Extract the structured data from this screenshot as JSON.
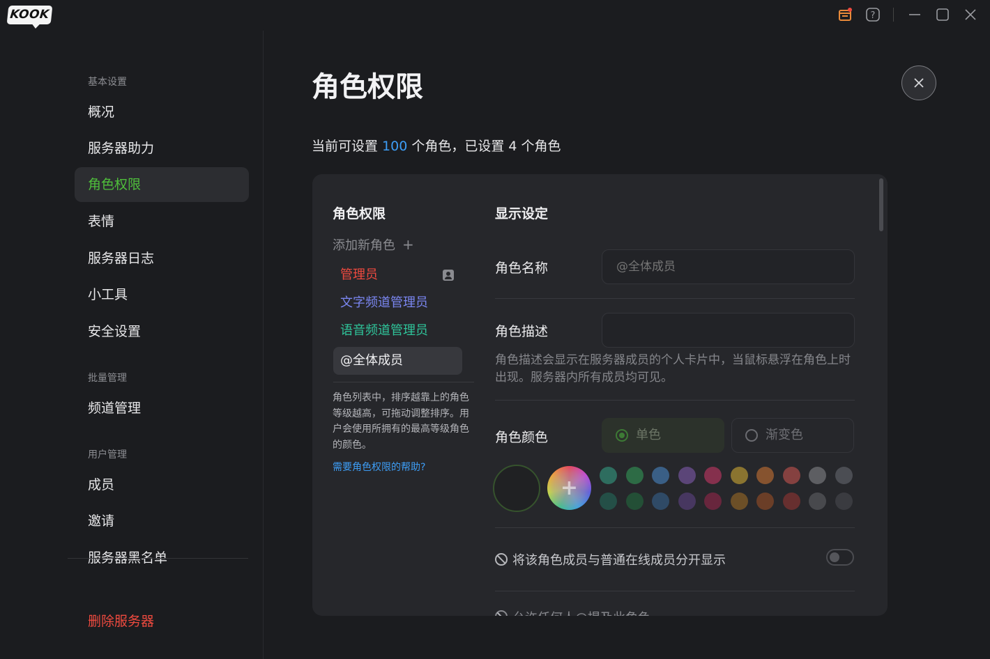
{
  "app": {
    "logo_text": "KOOK"
  },
  "titlebar": {
    "icons": [
      "store-icon",
      "help-icon",
      "minimize-icon",
      "maximize-icon",
      "close-icon"
    ]
  },
  "sidebar": {
    "sections": [
      {
        "label": "基本设置"
      },
      {
        "label": "批量管理"
      },
      {
        "label": "用户管理"
      }
    ],
    "items": [
      {
        "label": "概况"
      },
      {
        "label": "服务器助力"
      },
      {
        "label": "角色权限"
      },
      {
        "label": "表情"
      },
      {
        "label": "服务器日志"
      },
      {
        "label": "小工具"
      },
      {
        "label": "安全设置"
      },
      {
        "label": "频道管理"
      },
      {
        "label": "成员"
      },
      {
        "label": "邀请"
      },
      {
        "label": "服务器黑名单"
      }
    ],
    "active_index": 2,
    "delete_label": "删除服务器"
  },
  "page": {
    "title": "角色权限",
    "summary": {
      "prefix": "当前可设置 ",
      "max": "100",
      "middle": " 个角色，已设置 ",
      "count": "4",
      "suffix": " 个角色"
    }
  },
  "roles_panel": {
    "title": "角色权限",
    "add_label": "添加新角色",
    "add_icon": "+",
    "roles": [
      {
        "name": "管理员",
        "color": "#ef4a3f"
      },
      {
        "name": "文字频道管理员",
        "color": "#7a86f0"
      },
      {
        "name": "语音频道管理员",
        "color": "#2fc49a"
      },
      {
        "name": "@全体成员",
        "color": "#f0f0f2"
      }
    ],
    "selected_index": 3,
    "note": "角色列表中，排序越靠上的角色等级越高，可拖动调整排序。用户会使用所拥有的最高等级角色的颜色。",
    "help_link": "需要角色权限的帮助?"
  },
  "display": {
    "title": "显示设定",
    "name_label": "角色名称",
    "name_placeholder": "@全体成员",
    "desc_label": "角色描述",
    "desc_value": "",
    "desc_note": "角色描述会显示在服务器成员的个人卡片中，当鼠标悬浮在角色上时出现。服务器内所有成员均可见。",
    "color_label": "角色颜色",
    "color_mode_solid": "单色",
    "color_mode_gradient": "渐变色",
    "color_mode_selected": "单色",
    "swatch_row1": [
      "#2e6d5f",
      "#2d6b45",
      "#3a5f86",
      "#5b4578",
      "#85304d",
      "#8a7430",
      "#86532f",
      "#854140",
      "#5d5e62",
      "#4b4d53"
    ],
    "swatch_row2": [
      "#244f47",
      "#234f36",
      "#2f4a66",
      "#473760",
      "#68263d",
      "#6c4f27",
      "#6b3e27",
      "#672f2f",
      "#48494d",
      "#3a3b40"
    ],
    "separate_label": "将该角色成员与普通在线成员分开显示",
    "separate_on": false,
    "mention_label": "允许任何人@提及此角色"
  },
  "colors": {
    "accent_green": "#4fbf3b",
    "link_blue": "#3d9df5",
    "danger_red": "#ef4a3f"
  }
}
